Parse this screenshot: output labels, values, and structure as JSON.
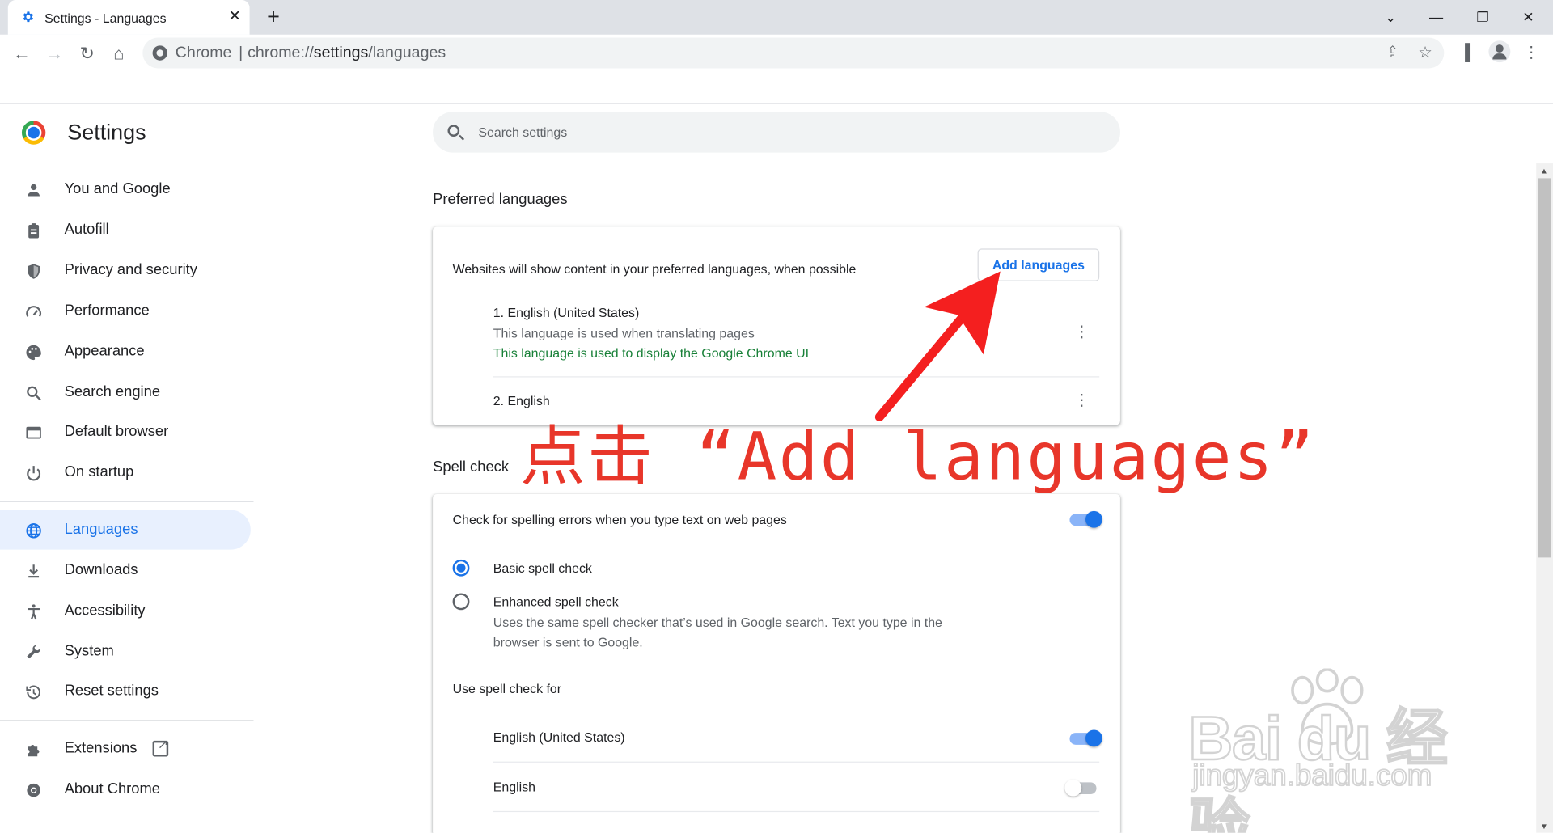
{
  "browser": {
    "tab_title": "Settings - Languages",
    "tab_close": "✕",
    "new_tab": "+",
    "omnibox_scheme": "Chrome",
    "omnibox_separator": "|",
    "omnibox_url_prefix": "chrome://",
    "omnibox_url_bold": "settings",
    "omnibox_url_suffix": "/languages"
  },
  "sidebar": {
    "title": "Settings",
    "items": [
      {
        "label": "You and Google",
        "icon": "person-icon"
      },
      {
        "label": "Autofill",
        "icon": "clipboard-icon"
      },
      {
        "label": "Privacy and security",
        "icon": "shield-icon"
      },
      {
        "label": "Performance",
        "icon": "gauge-icon"
      },
      {
        "label": "Appearance",
        "icon": "palette-icon"
      },
      {
        "label": "Search engine",
        "icon": "search-icon"
      },
      {
        "label": "Default browser",
        "icon": "browser-window-icon"
      },
      {
        "label": "On startup",
        "icon": "power-icon"
      },
      {
        "label": "Languages",
        "icon": "globe-icon",
        "active": true
      },
      {
        "label": "Downloads",
        "icon": "download-icon"
      },
      {
        "label": "Accessibility",
        "icon": "accessibility-icon"
      },
      {
        "label": "System",
        "icon": "wrench-icon"
      },
      {
        "label": "Reset settings",
        "icon": "history-icon"
      },
      {
        "label": "Extensions",
        "icon": "puzzle-icon"
      },
      {
        "label": "About Chrome",
        "icon": "chrome-icon"
      }
    ]
  },
  "search": {
    "placeholder": "Search settings"
  },
  "preferred_languages": {
    "heading": "Preferred languages",
    "description": "Websites will show content in your preferred languages, when possible",
    "add_button": "Add languages",
    "languages": [
      {
        "name": "1. English (United States)",
        "note": "This language is used when translating pages",
        "ui_note": "This language is used to display the Google Chrome UI"
      },
      {
        "name": "2. English"
      }
    ]
  },
  "spell_check": {
    "heading": "Spell check",
    "toggle_label": "Check for spelling errors when you type text on web pages",
    "toggle_on": true,
    "basic_label": "Basic spell check",
    "basic_selected": true,
    "enhanced_label": "Enhanced spell check",
    "enhanced_desc_1": "Uses the same spell checker that’s used in Google search. Text you type in the",
    "enhanced_desc_2": "browser is sent to Google.",
    "use_for_label": "Use spell check for",
    "languages": [
      {
        "name": "English (United States)",
        "enabled": true
      },
      {
        "name": "English",
        "enabled": false
      }
    ]
  },
  "annotation": {
    "text": "点击 “Add languages”",
    "color": "#e8362a"
  },
  "watermark": {
    "logo": "Bai du 经验",
    "url": "jingyan.baidu.com"
  },
  "colors": {
    "accent": "#1a73e8",
    "green_note": "#188038",
    "annotation": "#e8362a"
  }
}
